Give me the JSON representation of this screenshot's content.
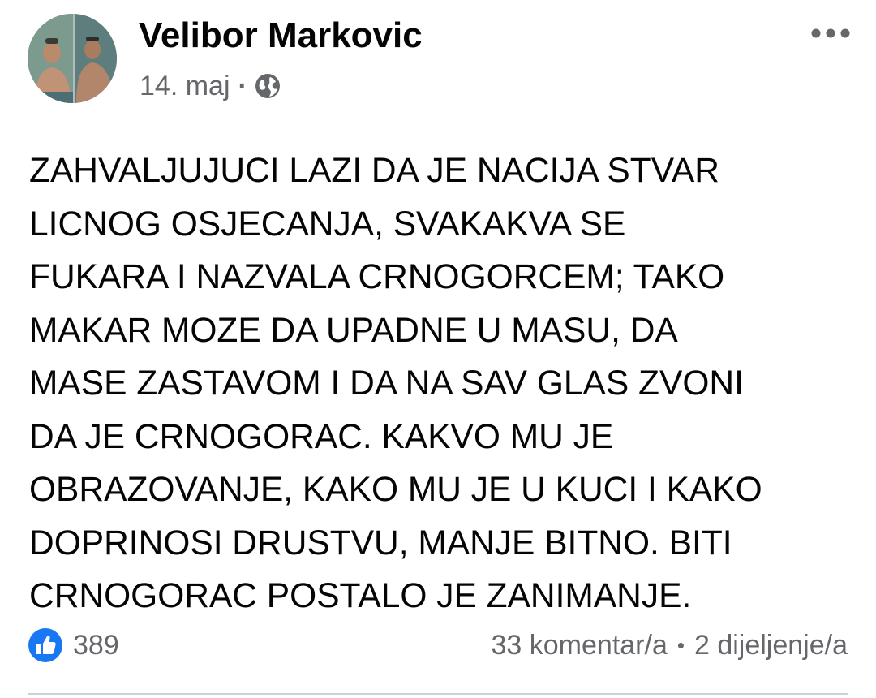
{
  "post": {
    "author_name": "Velibor Markovic",
    "date": "14. maj",
    "separator": "·",
    "privacy_icon": "globe-icon",
    "more_icon": "more-horizontal-icon",
    "text": "ZAHVALJUJUCI LAZI DA JE NACIJA STVAR\nLICNOG OSJECANJA, SVAKAKVA SE\nFUKARA I NAZVALA CRNOGORCEM; TAKO\nMAKAR MOZE DA UPADNE U MASU, DA\nMASE ZASTAVOM I DA NA SAV GLAS ZVONI\nDA JE CRNOGORAC. KAKVO MU JE\nOBRAZOVANJE, KAKO MU JE U KUCI I KAKO\nDOPRINOSI DRUSTVU, MANJE BITNO. BITI\nCRNOGORAC POSTALO JE ZANIMANJE."
  },
  "footer": {
    "like_icon": "thumbs-up-icon",
    "reaction_count": "389",
    "comments": "33 komentar/a",
    "dot": "•",
    "shares": "2 dijeljenje/a"
  },
  "colors": {
    "primary_text": "#050505",
    "secondary_text": "#65676b",
    "like_blue": "#1877f2",
    "divider": "#ced0d4"
  }
}
